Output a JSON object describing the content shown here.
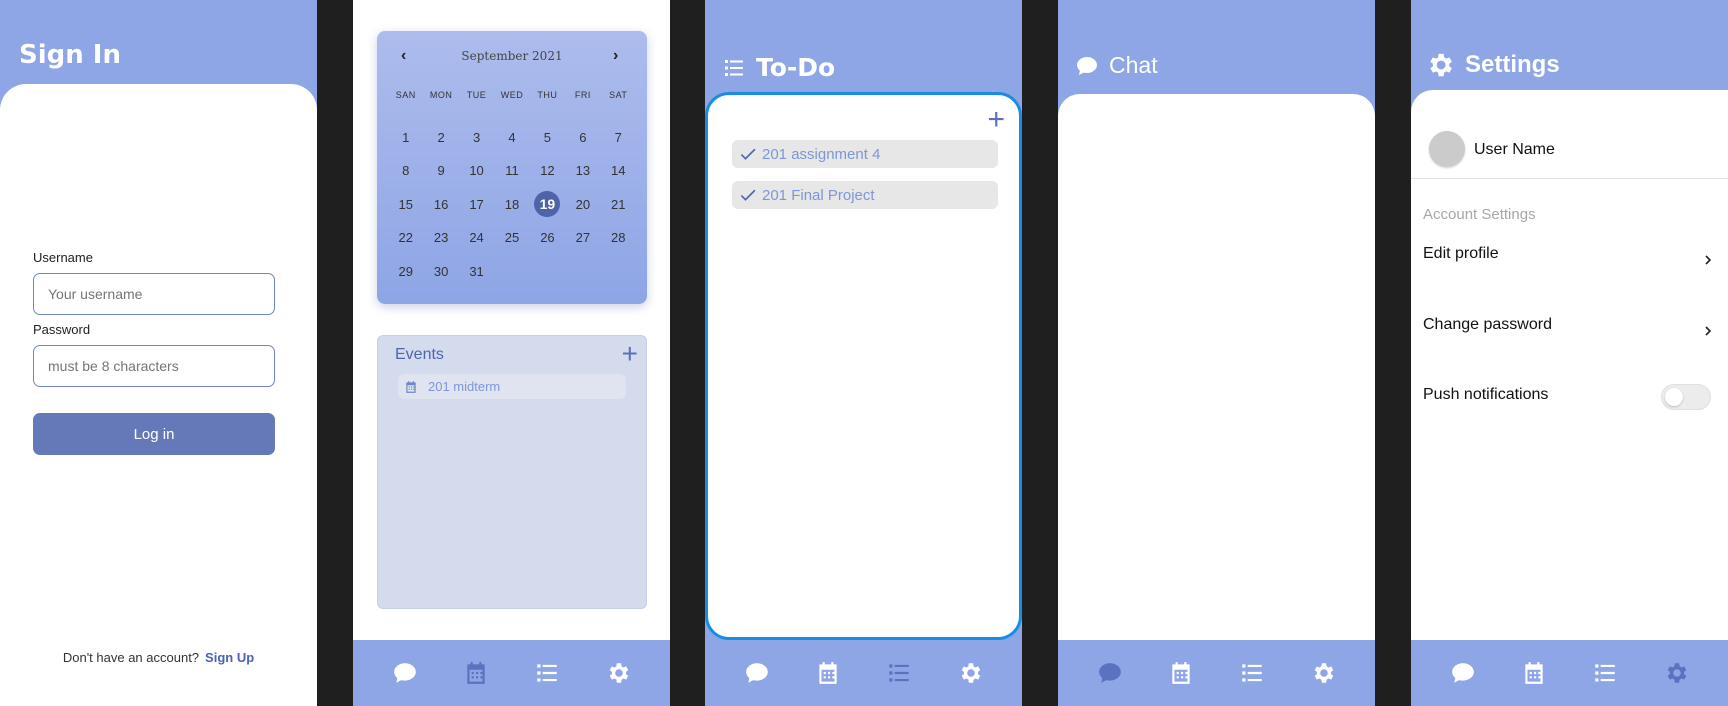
{
  "sign_in": {
    "title": "Sign In",
    "username_label": "Username",
    "username_placeholder": "Your username",
    "password_label": "Password",
    "password_placeholder": "must be 8 characters",
    "login_button": "Log in",
    "no_account_text": "Don't have an account?",
    "signup_link": "Sign Up"
  },
  "calendar": {
    "month_label": "September 2021",
    "prev": "‹",
    "next": "›",
    "weekdays": [
      "SAN",
      "MON",
      "TUE",
      "WED",
      "THU",
      "FRI",
      "SAT"
    ],
    "days": [
      "1",
      "2",
      "3",
      "4",
      "5",
      "6",
      "7",
      "8",
      "9",
      "10",
      "11",
      "12",
      "13",
      "14",
      "15",
      "16",
      "17",
      "18",
      "19",
      "20",
      "21",
      "22",
      "23",
      "24",
      "25",
      "26",
      "27",
      "28",
      "29",
      "30",
      "31"
    ],
    "selected_day": "19",
    "events_title": "Events",
    "events_add": "+",
    "events": [
      {
        "label": "201 midterm"
      }
    ]
  },
  "todo": {
    "title": "To-Do",
    "add": "+",
    "items": [
      {
        "label": "201 assignment 4"
      },
      {
        "label": "201 Final Project"
      }
    ]
  },
  "chat": {
    "title": "Chat"
  },
  "settings": {
    "title": "Settings",
    "user_name": "User Name",
    "account_settings_label": "Account Settings",
    "edit_profile": "Edit profile",
    "change_password": "Change password",
    "push_notifications": "Push notifications",
    "push_notifications_enabled": false
  },
  "nav": {
    "icons": [
      "chat-icon",
      "calendar-icon",
      "list-icon",
      "gear-icon"
    ]
  },
  "colors": {
    "header_blue": "#8ea5e6",
    "accent": "#6579b8",
    "highlight_border": "#1a8ce5"
  }
}
